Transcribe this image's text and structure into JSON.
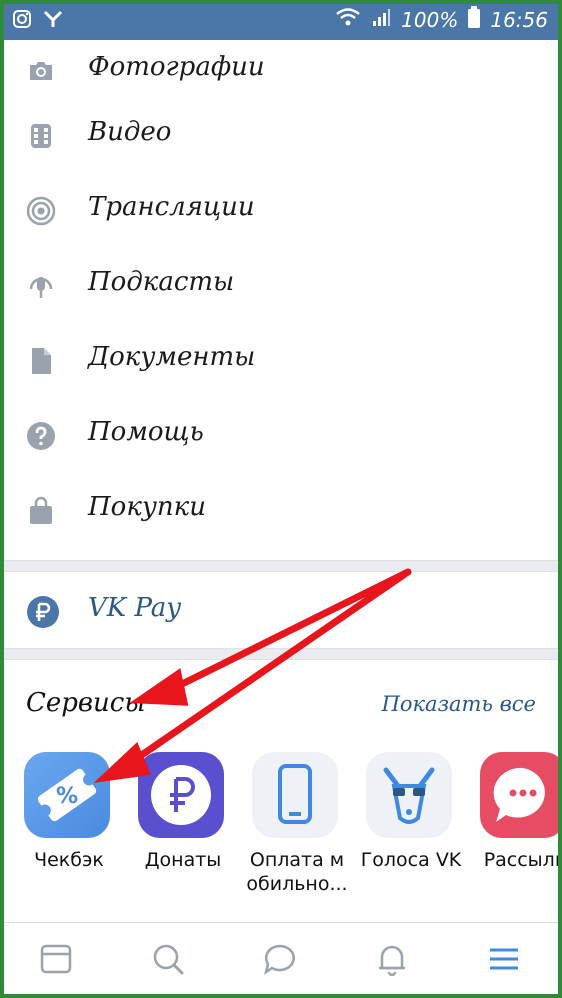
{
  "status_bar": {
    "battery": "100%",
    "time": "16:56",
    "icons": [
      "instagram-icon",
      "notification-icon",
      "wifi-icon",
      "signal-icon",
      "battery-icon"
    ]
  },
  "menu": {
    "items": [
      {
        "label": "Фотографии",
        "icon": "camera-icon"
      },
      {
        "label": "Видео",
        "icon": "video-icon"
      },
      {
        "label": "Трансляции",
        "icon": "live-icon"
      },
      {
        "label": "Подкасты",
        "icon": "podcast-icon"
      },
      {
        "label": "Документы",
        "icon": "document-icon"
      },
      {
        "label": "Помощь",
        "icon": "help-icon"
      },
      {
        "label": "Покупки",
        "icon": "shopping-bag-icon"
      }
    ]
  },
  "vkpay": {
    "label": "VK Pay",
    "icon": "ruble-icon"
  },
  "services": {
    "title": "Сервисы",
    "show_all": "Показать все",
    "items": [
      {
        "name": "Чекбэк",
        "icon": "cashback-ticket-icon",
        "color": "#5b9be8"
      },
      {
        "name": "Донаты",
        "icon": "donate-ruble-icon",
        "color": "#5a4fcf"
      },
      {
        "name": "Оплата м обильно...",
        "icon": "mobile-payment-icon",
        "color": "#eef2f7"
      },
      {
        "name": "Голоса VK",
        "icon": "votes-dog-icon",
        "color": "#eef2f7"
      },
      {
        "name": "Рассылк",
        "icon": "newsletter-icon",
        "color": "#e64d64"
      }
    ]
  },
  "bottom_nav": {
    "items": [
      "news-icon",
      "search-icon",
      "messages-icon",
      "notifications-icon",
      "menu-icon"
    ],
    "active": "menu-icon"
  },
  "colors": {
    "header": "#4a76a8",
    "link": "#2a5885",
    "annotation_arrow": "#e8161c",
    "frame": "#2f8a3a"
  }
}
